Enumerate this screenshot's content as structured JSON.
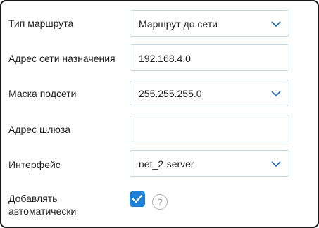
{
  "form": {
    "route_type": {
      "label": "Тип маршрута",
      "value": "Маршрут до сети"
    },
    "dest_network": {
      "label": "Адрес сети назначения",
      "value": "192.168.4.0"
    },
    "subnet_mask": {
      "label": "Маска подсети",
      "value": "255.255.255.0"
    },
    "gateway": {
      "label": "Адрес шлюза",
      "value": ""
    },
    "interface": {
      "label": "Интерфейс",
      "value": "net_2-server"
    },
    "auto_add": {
      "label_line1": "Добавлять",
      "label_line2": "автоматически",
      "checked": true
    }
  },
  "icons": {
    "dropdown": "chevron-down-icon",
    "checkbox": "check-icon",
    "help": "question-circle-icon",
    "help_glyph": "?"
  },
  "colors": {
    "accent": "#1f7fd4",
    "field_border": "#c5d7e4",
    "chevron": "#1f6fb0"
  }
}
